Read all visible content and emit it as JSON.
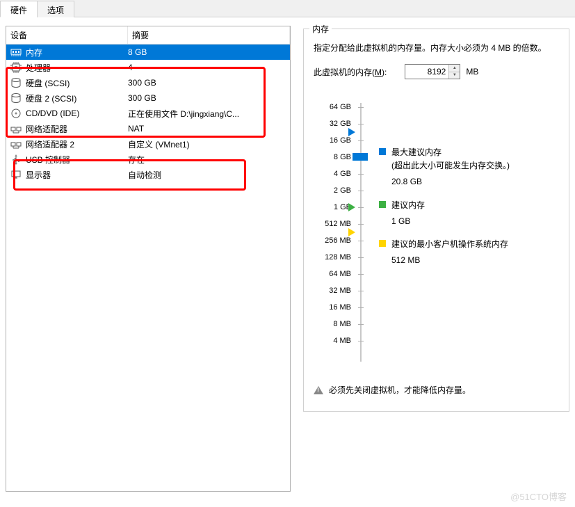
{
  "tabs": {
    "hardware": "硬件",
    "options": "选项"
  },
  "table": {
    "headers": {
      "device": "设备",
      "summary": "摘要"
    },
    "rows": [
      {
        "icon": "memory",
        "name": "内存",
        "summary": "8 GB",
        "selected": true
      },
      {
        "icon": "cpu",
        "name": "处理器",
        "summary": "4"
      },
      {
        "icon": "disk",
        "name": "硬盘 (SCSI)",
        "summary": "300 GB"
      },
      {
        "icon": "disk",
        "name": "硬盘 2 (SCSI)",
        "summary": "300 GB"
      },
      {
        "icon": "cd",
        "name": "CD/DVD (IDE)",
        "summary": "正在使用文件 D:\\jingxiang\\C..."
      },
      {
        "icon": "net",
        "name": "网络适配器",
        "summary": "NAT"
      },
      {
        "icon": "net",
        "name": "网络适配器 2",
        "summary": "自定义 (VMnet1)"
      },
      {
        "icon": "usb",
        "name": "USB 控制器",
        "summary": "存在"
      },
      {
        "icon": "display",
        "name": "显示器",
        "summary": "自动检测"
      }
    ]
  },
  "memory": {
    "group_title": "内存",
    "description": "指定分配给此虚拟机的内存量。内存大小必须为 4 MB 的倍数。",
    "label_prefix": "此虚拟机的内存(",
    "label_key": "M",
    "label_suffix": "):",
    "value": "8192",
    "unit": "MB",
    "ticks": [
      "64 GB",
      "32 GB",
      "16 GB",
      "8 GB",
      "4 GB",
      "2 GB",
      "1 GB",
      "512 MB",
      "256 MB",
      "128 MB",
      "64 MB",
      "32 MB",
      "16 MB",
      "8 MB",
      "4 MB"
    ],
    "legend": {
      "max": {
        "label": "最大建议内存",
        "note": "(超出此大小可能发生内存交换。)",
        "value": "20.8 GB"
      },
      "rec": {
        "label": "建议内存",
        "value": "1 GB"
      },
      "min": {
        "label": "建议的最小客户机操作系统内存",
        "value": "512 MB"
      }
    },
    "warning": "必须先关闭虚拟机，才能降低内存量。"
  },
  "watermark": "@51CTO博客"
}
